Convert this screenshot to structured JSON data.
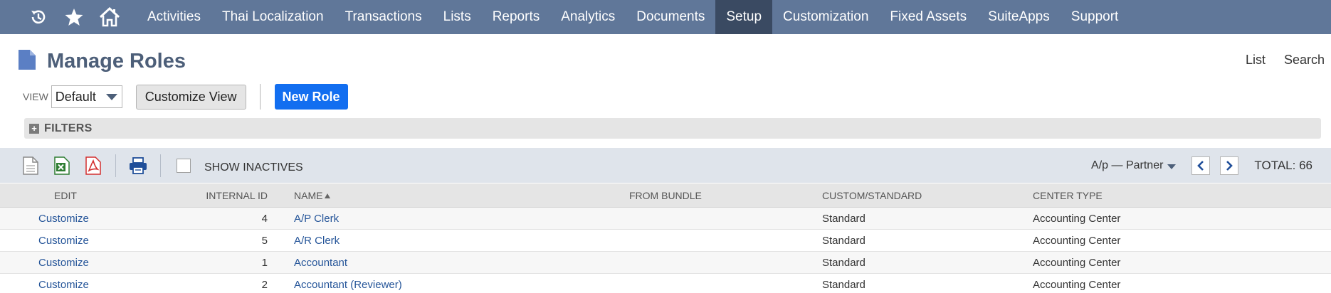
{
  "nav": {
    "items": [
      {
        "label": "Activities",
        "active": false
      },
      {
        "label": "Thai Localization",
        "active": false
      },
      {
        "label": "Transactions",
        "active": false
      },
      {
        "label": "Lists",
        "active": false
      },
      {
        "label": "Reports",
        "active": false
      },
      {
        "label": "Analytics",
        "active": false
      },
      {
        "label": "Documents",
        "active": false
      },
      {
        "label": "Setup",
        "active": true
      },
      {
        "label": "Customization",
        "active": false
      },
      {
        "label": "Fixed Assets",
        "active": false
      },
      {
        "label": "SuiteApps",
        "active": false
      },
      {
        "label": "Support",
        "active": false
      }
    ],
    "icons": [
      "recent-records-icon",
      "star-icon",
      "home-icon"
    ]
  },
  "header": {
    "title": "Manage Roles",
    "links": {
      "list": "List",
      "search": "Search"
    }
  },
  "controls": {
    "view_label": "VIEW",
    "view_value": "Default",
    "customize_view": "Customize View",
    "new_role": "New Role"
  },
  "filters": {
    "label": "FILTERS"
  },
  "toolbar": {
    "show_inactives": "SHOW INACTIVES",
    "range": "A/p — Partner",
    "total": "TOTAL: 66"
  },
  "table": {
    "columns": {
      "edit": "EDIT",
      "internal_id": "INTERNAL ID",
      "name": "NAME",
      "from_bundle": "FROM BUNDLE",
      "custom_standard": "CUSTOM/STANDARD",
      "center_type": "CENTER TYPE"
    },
    "rows": [
      {
        "edit": "Customize",
        "internal_id": "4",
        "name": "A/P Clerk",
        "from_bundle": "",
        "custom_standard": "Standard",
        "center_type": "Accounting Center"
      },
      {
        "edit": "Customize",
        "internal_id": "5",
        "name": "A/R Clerk",
        "from_bundle": "",
        "custom_standard": "Standard",
        "center_type": "Accounting Center"
      },
      {
        "edit": "Customize",
        "internal_id": "1",
        "name": "Accountant",
        "from_bundle": "",
        "custom_standard": "Standard",
        "center_type": "Accounting Center"
      },
      {
        "edit": "Customize",
        "internal_id": "2",
        "name": "Accountant (Reviewer)",
        "from_bundle": "",
        "custom_standard": "Standard",
        "center_type": "Accounting Center"
      }
    ]
  },
  "colors": {
    "nav_bg": "#607799",
    "nav_active": "#3a4a62",
    "title": "#4d5f79",
    "primary_button": "#126ef0",
    "link": "#255599",
    "toolbar_bg": "#dfe4eb"
  }
}
